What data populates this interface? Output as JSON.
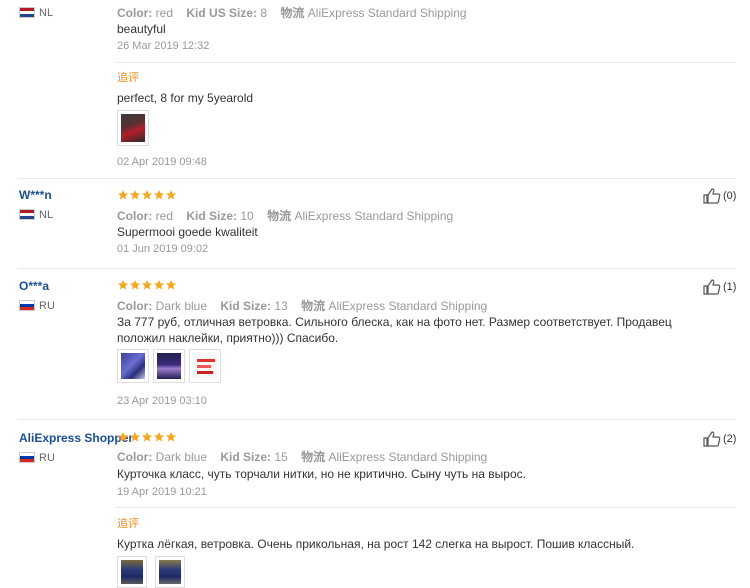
{
  "reviews": [
    {
      "country": "NL",
      "color_label": "Color:",
      "color_value": "red",
      "size_label": "Kid US Size:",
      "size_value": "8",
      "ship_label": "物流",
      "ship_value": "AliExpress Standard Shipping",
      "text": "beautyful",
      "date": "26 Mar 2019 12:32",
      "additional": {
        "label": "追评",
        "text": "perfect, 8 for my 5yearold",
        "date": "02 Apr 2019 09:48"
      }
    },
    {
      "user": "W***n",
      "country": "NL",
      "rating": 5,
      "color_label": "Color:",
      "color_value": "red",
      "size_label": "Kid Size:",
      "size_value": "10",
      "ship_label": "物流",
      "ship_value": "AliExpress Standard Shipping",
      "text": "Supermooi goede kwaliteit",
      "date": "01 Jun 2019 09:02",
      "likes": "(0)"
    },
    {
      "user": "O***a",
      "country": "RU",
      "rating": 5,
      "color_label": "Color:",
      "color_value": "Dark blue",
      "size_label": "Kid Size:",
      "size_value": "13",
      "ship_label": "物流",
      "ship_value": "AliExpress Standard Shipping",
      "text": "За 777 руб, отличная ветровка. Сильного блеска, как на фото нет. Размер соответствует. Продавец положил наклейки, приятно))) Спасибо.",
      "date": "23 Apr 2019 03:10",
      "likes": "(1)"
    },
    {
      "user": "AliExpress Shopper",
      "country": "RU",
      "rating": 5,
      "color_label": "Color:",
      "color_value": "Dark blue",
      "size_label": "Kid Size:",
      "size_value": "15",
      "ship_label": "物流",
      "ship_value": "AliExpress Standard Shipping",
      "text": "Курточка класс, чуть торчали нитки, но не критично. Сыну чуть на вырос.",
      "date": "19 Apr 2019 10:21",
      "likes": "(2)",
      "additional": {
        "label": "追评",
        "text": "Куртка лёгкая, ветровка. Очень прикольная, на рост 142 слегка на вырост. Пошив классный."
      }
    }
  ],
  "colors": {
    "star": "#f5a623",
    "username": "#1b4f93",
    "meta": "#999999",
    "additional_label": "#f08c1a"
  }
}
